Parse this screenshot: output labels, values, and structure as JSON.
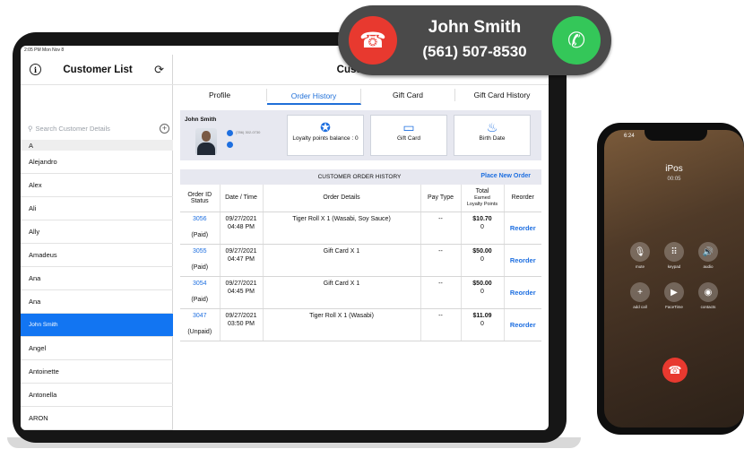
{
  "status_bar": {
    "time": "2:05 PM  Mon Nov 8"
  },
  "sidebar": {
    "title": "Customer List",
    "search_placeholder": "Search Customer Details",
    "section": "A",
    "customers": [
      "Alejandro",
      "Alex",
      "Ali",
      "Ally",
      "Amadeus",
      "Ana",
      "Ana",
      "John Smith",
      "Angel",
      "Antoinette",
      "Antonella",
      "ARON"
    ],
    "selected": "John Smith"
  },
  "main": {
    "title": "Customer",
    "tabs": [
      "Profile",
      "Order History",
      "Gift Card",
      "Gift Card History"
    ],
    "active_tab": "Order History",
    "profile": {
      "name": "John Smith",
      "phone": "(786) 302-0730",
      "cards": [
        "Loyalty points balance : 0",
        "Gift Card",
        "Birth Date"
      ]
    },
    "history": {
      "title": "CUSTOMER ORDER HISTORY",
      "place_new": "Place New Order",
      "headers": {
        "id": "Order ID",
        "status": "Status",
        "date": "Date / Time",
        "details": "Order Details",
        "pay": "Pay Type",
        "total": "Total",
        "earned": "Earned",
        "loyalty": "Loyalty Points",
        "reorder": "Reorder"
      },
      "rows": [
        {
          "id": "3056",
          "status": "(Paid)",
          "date": "09/27/2021",
          "time": "04:48 PM",
          "details": "Tiger Roll X 1 (Wasabi, Soy Sauce)",
          "pay": "--",
          "total": "$10.70",
          "points": "0",
          "action": "Reorder"
        },
        {
          "id": "3055",
          "status": "(Paid)",
          "date": "09/27/2021",
          "time": "04:47 PM",
          "details": "Gift Card X 1",
          "pay": "--",
          "total": "$50.00",
          "points": "0",
          "action": "Reorder"
        },
        {
          "id": "3054",
          "status": "(Paid)",
          "date": "09/27/2021",
          "time": "04:45 PM",
          "details": "Gift Card X 1",
          "pay": "--",
          "total": "$50.00",
          "points": "0",
          "action": "Reorder"
        },
        {
          "id": "3047",
          "status": "(Unpaid)",
          "date": "09/27/2021",
          "time": "03:50 PM",
          "details": "Tiger Roll X 1 (Wasabi)",
          "pay": "--",
          "total": "$11.09",
          "points": "0",
          "action": "Reorder"
        }
      ]
    }
  },
  "call_banner": {
    "name": "John Smith",
    "number": "(561) 507-8530"
  },
  "iphone": {
    "time": "6:24",
    "title": "iPos",
    "duration": "00:05",
    "buttons": [
      "mute",
      "keypad",
      "audio",
      "add call",
      "FaceTime",
      "contacts"
    ]
  }
}
